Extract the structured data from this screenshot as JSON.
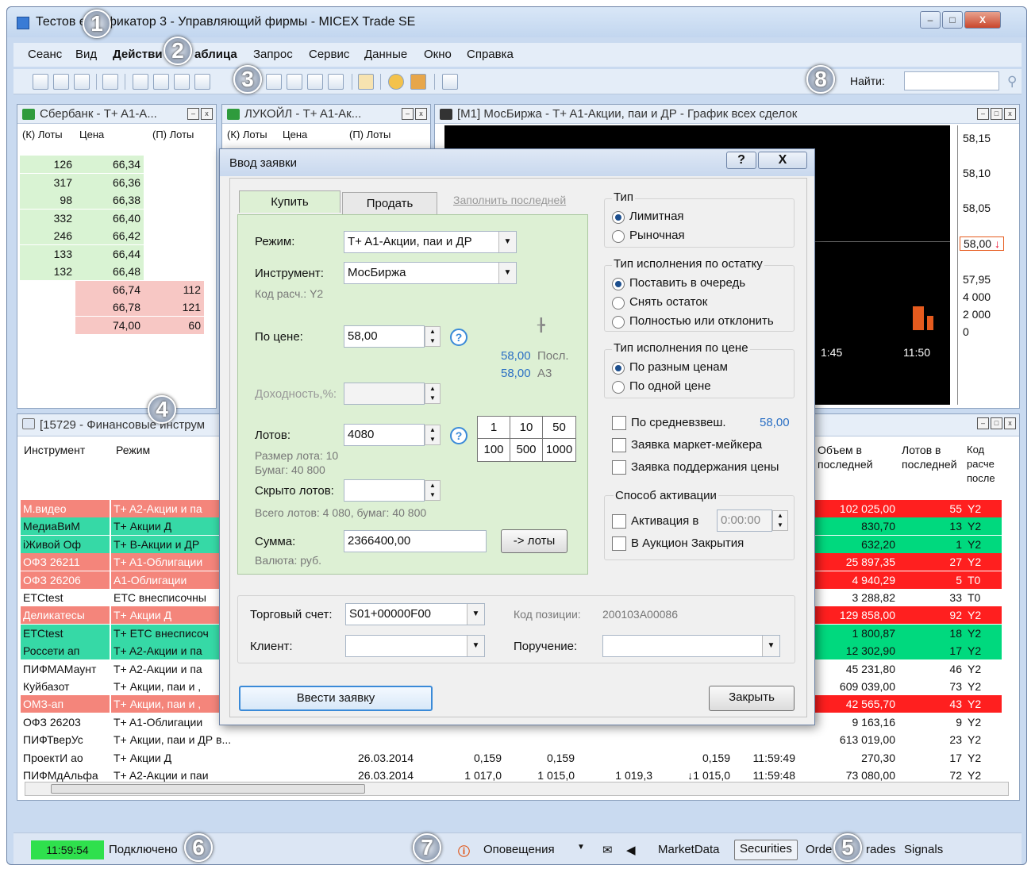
{
  "window": {
    "title": "Тестов  ентификатор 3 - Управляющий фирмы - MICEX Trade SE",
    "min": "–",
    "max": "□",
    "close": "X"
  },
  "menu": [
    "Сеанс",
    "Вид",
    "Действи",
    "аблица",
    "Запрос",
    "Сервис",
    "Данные",
    "Окно",
    "Справка"
  ],
  "find": {
    "label": "Найти:",
    "icon": "magnifier-icon"
  },
  "orderbook1": {
    "title": "Сбербанк - T+ A1-A...",
    "headers": [
      "(К) Лоты",
      "Цена",
      "(П) Лоты"
    ],
    "rows": [
      [
        "126",
        "66,34",
        ""
      ],
      [
        "317",
        "66,36",
        ""
      ],
      [
        "98",
        "66,38",
        ""
      ],
      [
        "332",
        "66,40",
        ""
      ],
      [
        "246",
        "66,42",
        ""
      ],
      [
        "133",
        "66,44",
        ""
      ],
      [
        "132",
        "66,48",
        ""
      ],
      [
        "",
        "66,74",
        "112"
      ],
      [
        "",
        "66,78",
        "121"
      ],
      [
        "",
        "74,00",
        "60"
      ]
    ]
  },
  "orderbook2": {
    "title": "ЛУКОЙЛ - T+ A1-Ак...",
    "headers": [
      "(К) Лоты",
      "Цена",
      "(П) Лоты"
    ]
  },
  "chartpane": {
    "title": "[M1] МосБиржа - T+ A1-Акции, паи и ДР - График всех сделок",
    "prices": [
      "58,15",
      "58,10",
      "58,05",
      "58,00",
      "57,95"
    ],
    "current": "58,00",
    "arrow": "↓",
    "volumes": [
      "4 000",
      "2 000",
      "0"
    ],
    "times": [
      "1:45",
      "11:50"
    ]
  },
  "table": {
    "title": "[15729 - Финансовые инструм",
    "headers": [
      "Инструмент",
      "Режим",
      "Объем в последней",
      "Лотов в последней",
      "Код расче после"
    ],
    "rows": [
      {
        "i": "М.видео",
        "m": "T+ A2-Акции и па",
        "d": "",
        "c1": "",
        "c2": "",
        "c3": "",
        "c4": "",
        "t": "",
        "vol": "102 025,00",
        "lots": "55",
        "code": "Y2",
        "style": "r-salmon",
        "rs": "r-red"
      },
      {
        "i": "МедиаВиМ",
        "m": "T+ Акции Д",
        "d": "",
        "c1": "",
        "c2": "",
        "c3": "",
        "c4": "",
        "t": "",
        "vol": "830,70",
        "lots": "13",
        "code": "Y2",
        "style": "r-mint",
        "rs": "r-green"
      },
      {
        "i": "iЖивой Оф",
        "m": "T+ B-Акции и ДР",
        "d": "",
        "c1": "",
        "c2": "",
        "c3": "",
        "c4": "",
        "t": "",
        "vol": "632,20",
        "lots": "1",
        "code": "Y2",
        "style": "r-mint",
        "rs": "r-green"
      },
      {
        "i": "ОФЗ 26211",
        "m": "T+ A1-Облигации",
        "d": "",
        "c1": "",
        "c2": "",
        "c3": "",
        "c4": "",
        "t": "",
        "vol": "25 897,35",
        "lots": "27",
        "code": "Y2",
        "style": "r-salmon",
        "rs": "r-red"
      },
      {
        "i": "ОФЗ 26206",
        "m": "A1-Облигации",
        "d": "",
        "c1": "",
        "c2": "",
        "c3": "",
        "c4": "",
        "t": "",
        "vol": "4 940,29",
        "lots": "5",
        "code": "T0",
        "style": "r-salmon",
        "rs": "r-red"
      },
      {
        "i": "ETCtest",
        "m": "ETC внесписочны",
        "d": "",
        "c1": "",
        "c2": "",
        "c3": "",
        "c4": "",
        "t": "",
        "vol": "3 288,82",
        "lots": "33",
        "code": "T0",
        "style": "",
        "rs": ""
      },
      {
        "i": "Деликатесы",
        "m": "T+ Акции Д",
        "d": "",
        "c1": "",
        "c2": "",
        "c3": "",
        "c4": "",
        "t": "",
        "vol": "129 858,00",
        "lots": "92",
        "code": "Y2",
        "style": "r-salmon",
        "rs": "r-red"
      },
      {
        "i": "ETCtest",
        "m": "T+ ETC внесписоч",
        "d": "",
        "c1": "",
        "c2": "",
        "c3": "",
        "c4": "",
        "t": "",
        "vol": "1 800,87",
        "lots": "18",
        "code": "Y2",
        "style": "r-mint",
        "rs": "r-green"
      },
      {
        "i": "Россети ап",
        "m": "T+ A2-Акции и па",
        "d": "",
        "c1": "",
        "c2": "",
        "c3": "",
        "c4": "",
        "t": "",
        "vol": "12 302,90",
        "lots": "17",
        "code": "Y2",
        "style": "r-mint",
        "rs": "r-green"
      },
      {
        "i": "ПИФМАМаунт",
        "m": "T+ A2-Акции и па",
        "d": "",
        "c1": "",
        "c2": "",
        "c3": "",
        "c4": "",
        "t": "",
        "vol": "45 231,80",
        "lots": "46",
        "code": "Y2",
        "style": "",
        "rs": ""
      },
      {
        "i": "Куйбазот",
        "m": "T+ Акции, паи и ,",
        "d": "",
        "c1": "",
        "c2": "",
        "c3": "",
        "c4": "",
        "t": "",
        "vol": "609 039,00",
        "lots": "73",
        "code": "Y2",
        "style": "",
        "rs": ""
      },
      {
        "i": "ОМЗ-ап",
        "m": "T+ Акции, паи и ,",
        "d": "",
        "c1": "",
        "c2": "",
        "c3": "",
        "c4": "",
        "t": "",
        "vol": "42 565,70",
        "lots": "43",
        "code": "Y2",
        "style": "r-salmon",
        "rs": "r-red"
      },
      {
        "i": "ОФЗ 26203",
        "m": "T+ A1-Облигации",
        "d": "",
        "c1": "",
        "c2": "",
        "c3": "",
        "c4": "",
        "t": "",
        "vol": "9 163,16",
        "lots": "9",
        "code": "Y2",
        "style": "",
        "rs": ""
      },
      {
        "i": "ПИФТверУс",
        "m": "T+ Акции, паи и ДР в...",
        "d": "",
        "c1": "",
        "c2": "",
        "c3": "",
        "c4": "",
        "t": "",
        "vol": "613 019,00",
        "lots": "23",
        "code": "Y2",
        "style": "",
        "rs": ""
      },
      {
        "i": "ПроектИ ао",
        "m": "T+ Акции Д",
        "d": "26.03.2014",
        "c1": "0,159",
        "c2": "0,159",
        "c3": "",
        "c4": "0,159",
        "t": "11:59:49",
        "vol": "270,30",
        "lots": "17",
        "code": "Y2",
        "style": "",
        "rs": ""
      },
      {
        "i": "ПИФМдАльфа",
        "m": "T+ A2-Акции и паи",
        "d": "26.03.2014",
        "c1": "1 017,0",
        "c2": "1 015,0",
        "c3": "1 019,3",
        "c4": "↓1 015,0",
        "t": "11:59:48",
        "vol": "73 080,00",
        "lots": "72",
        "code": "Y2",
        "style": "",
        "rs": ""
      }
    ]
  },
  "dialog": {
    "title": "Ввод заявки",
    "help_btn": "?",
    "close_btn": "X",
    "tabs": {
      "buy": "Купить",
      "sell": "Продать",
      "fill_last": "Заполнить последней"
    },
    "mode_label": "Режим:",
    "mode_value": "T+ A1-Акции, паи и ДР",
    "instr_label": "Инструмент:",
    "instr_value": "МосБиржа",
    "settle_code": "Код расч.: Y2",
    "price_label": "По цене:",
    "price_value": "58,00",
    "last_price": "58,00",
    "last_label": "Посл.",
    "a3_price": "58,00",
    "a3_label": "А3",
    "yield_label": "Доходность,%:",
    "lots_label": "Лотов:",
    "lots_value": "4080",
    "lot_size": "Размер лота: 10",
    "papers": "Бумаг: 40 800",
    "lot_grid": [
      "1",
      "10",
      "50",
      "100",
      "500",
      "1000"
    ],
    "hidden_label": "Скрыто лотов:",
    "total": "Всего лотов: 4 080, бумаг: 40 800",
    "sum_label": "Сумма:",
    "sum_value": "2366400,00",
    "to_lots": "-> лоты",
    "currency": "Валюта: руб.",
    "type_title": "Тип",
    "type_limit": "Лимитная",
    "type_market": "Рыночная",
    "rest_title": "Тип исполнения по остатку",
    "rest_1": "Поставить в очередь",
    "rest_2": "Снять остаток",
    "rest_3": "Полностью или отклонить",
    "price_exec_title": "Тип исполнения по цене",
    "pe_1": "По разным ценам",
    "pe_2": "По одной цене",
    "avg_label": "По средневзвеш.",
    "avg_value": "58,00",
    "mm_label": "Заявка маркет-мейкера",
    "support_label": "Заявка поддержания цены",
    "activ_title": "Способ активации",
    "activ_at": "Активация в",
    "activ_time": "0:00:00",
    "auction": "В Аукцион Закрытия",
    "account_label": "Торговый счет:",
    "account_value": "S01+00000F00",
    "pos_label": "Код позиции:",
    "pos_value": "200103A00086",
    "client_label": "Клиент:",
    "order_label": "Поручение:",
    "submit": "Ввести заявку",
    "close": "Закрыть"
  },
  "status": {
    "clock": "11:59:54",
    "connected": "Подключено",
    "alerts": "Оповещения",
    "tabs": [
      "MarketData",
      "Securities",
      "Orde",
      "rades",
      "Signals"
    ]
  },
  "badges": [
    "1",
    "2",
    "3",
    "4",
    "5",
    "6",
    "7",
    "8"
  ]
}
